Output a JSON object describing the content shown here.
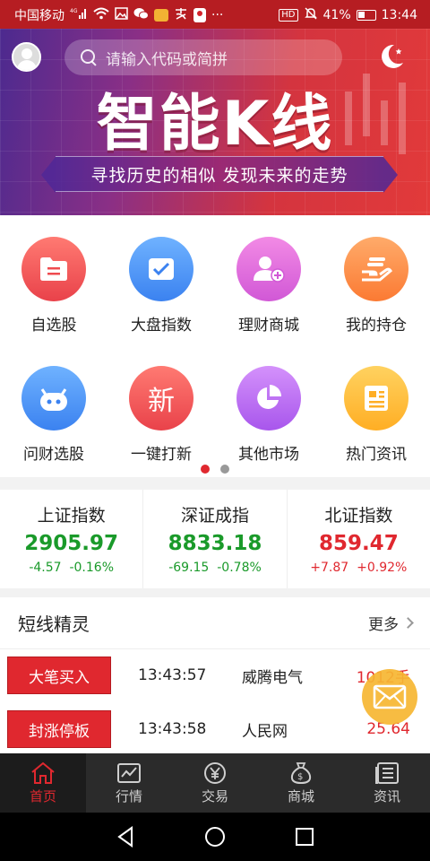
{
  "status_bar": {
    "carrier": "中国移动",
    "network": "4G",
    "more": "···",
    "hd": "HD",
    "battery_percent_text": "41%",
    "battery_level": 0.41,
    "time": "13:44"
  },
  "banner": {
    "search_placeholder": "请输入代码或简拼",
    "title": "智能K线",
    "subtitle": "寻找历史的相似  发现未来的走势"
  },
  "menu": {
    "items": [
      {
        "label": "自选股",
        "icon": "folder-icon",
        "color": "#ef4b4f"
      },
      {
        "label": "大盘指数",
        "icon": "chart-check-icon",
        "color": "#3b82f0"
      },
      {
        "label": "理财商城",
        "icon": "user-add-icon",
        "color": "#d158d6"
      },
      {
        "label": "我的持仓",
        "icon": "hand-coins-icon",
        "color": "#fb7a33"
      },
      {
        "label": "问财选股",
        "icon": "robot-icon",
        "color": "#3b82f0"
      },
      {
        "label": "一键打新",
        "icon": "new-badge-icon",
        "color": "#ef4b4f",
        "icon_text": "新"
      },
      {
        "label": "其他市场",
        "icon": "pie-chart-icon",
        "color": "#a856ec"
      },
      {
        "label": "热门资讯",
        "icon": "news-icon",
        "color": "#ffae24"
      }
    ],
    "pages": 2,
    "current_page": 1
  },
  "indices": [
    {
      "name": "上证指数",
      "value": "2905.97",
      "change": "-4.57",
      "change_pct": "-0.16%",
      "trend": "down"
    },
    {
      "name": "深证成指",
      "value": "8833.18",
      "change": "-69.15",
      "change_pct": "-0.78%",
      "trend": "down"
    },
    {
      "name": "北证指数",
      "value": "859.47",
      "change": "+7.87",
      "change_pct": "+0.92%",
      "trend": "up"
    }
  ],
  "spirit": {
    "title": "短线精灵",
    "more_label": "更多",
    "rows": [
      {
        "tag": "大笔买入",
        "time": "13:43:57",
        "stock": "威腾电气",
        "amount": "1012手"
      },
      {
        "tag": "封涨停板",
        "time": "13:43:58",
        "stock": "人民网",
        "amount": "25.64"
      }
    ]
  },
  "tabbar": {
    "tabs": [
      {
        "label": "首页",
        "icon": "home-icon",
        "active": true
      },
      {
        "label": "行情",
        "icon": "market-chart-icon",
        "active": false
      },
      {
        "label": "交易",
        "icon": "yuan-icon",
        "active": false
      },
      {
        "label": "商城",
        "icon": "money-bag-icon",
        "active": false
      },
      {
        "label": "资讯",
        "icon": "news-list-icon",
        "active": false
      }
    ]
  },
  "colors": {
    "accent_red": "#e0282f",
    "down_green": "#1a9a2a",
    "status_bar": "#b61d22"
  }
}
